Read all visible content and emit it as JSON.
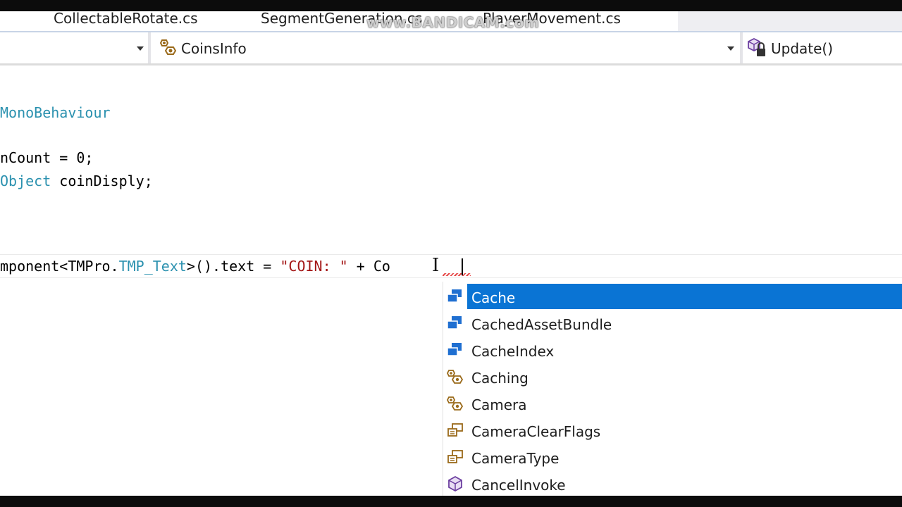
{
  "tabs": [
    {
      "label": "CollectableRotate.cs"
    },
    {
      "label": "SegmentGeneration.cs"
    },
    {
      "label": "PlayerMovement.cs"
    }
  ],
  "watermark": "www.BANDICAM.com",
  "navbar": {
    "type_dropdown": "CoinsInfo",
    "member_dropdown": "Update()"
  },
  "code_lines": {
    "line1": {
      "type": "MonoBehaviour"
    },
    "line2": {
      "a": "nCount = 0;"
    },
    "line3": {
      "type": "Object",
      "rest": " coinDisply;"
    },
    "line4": {
      "a": "mponent<TMPro.",
      "type": "TMP_Text",
      "b": ">().text = ",
      "str": "\"COIN: \"",
      "c": " + ",
      "typed": "Co"
    }
  },
  "completion": {
    "items": [
      {
        "label": "Cache",
        "icon": "class-icon",
        "selected": true
      },
      {
        "label": "CachedAssetBundle",
        "icon": "class-icon",
        "selected": false
      },
      {
        "label": "CacheIndex",
        "icon": "class-icon",
        "selected": false
      },
      {
        "label": "Caching",
        "icon": "utility-class-icon",
        "selected": false
      },
      {
        "label": "Camera",
        "icon": "utility-class-icon",
        "selected": false
      },
      {
        "label": "CameraClearFlags",
        "icon": "enum-icon",
        "selected": false
      },
      {
        "label": "CameraType",
        "icon": "enum-icon",
        "selected": false
      },
      {
        "label": "CancelInvoke",
        "icon": "method-icon",
        "selected": false
      }
    ]
  },
  "colors": {
    "keyword_type": "#2b91af",
    "string": "#a31515",
    "selection": "#0a74d4"
  }
}
